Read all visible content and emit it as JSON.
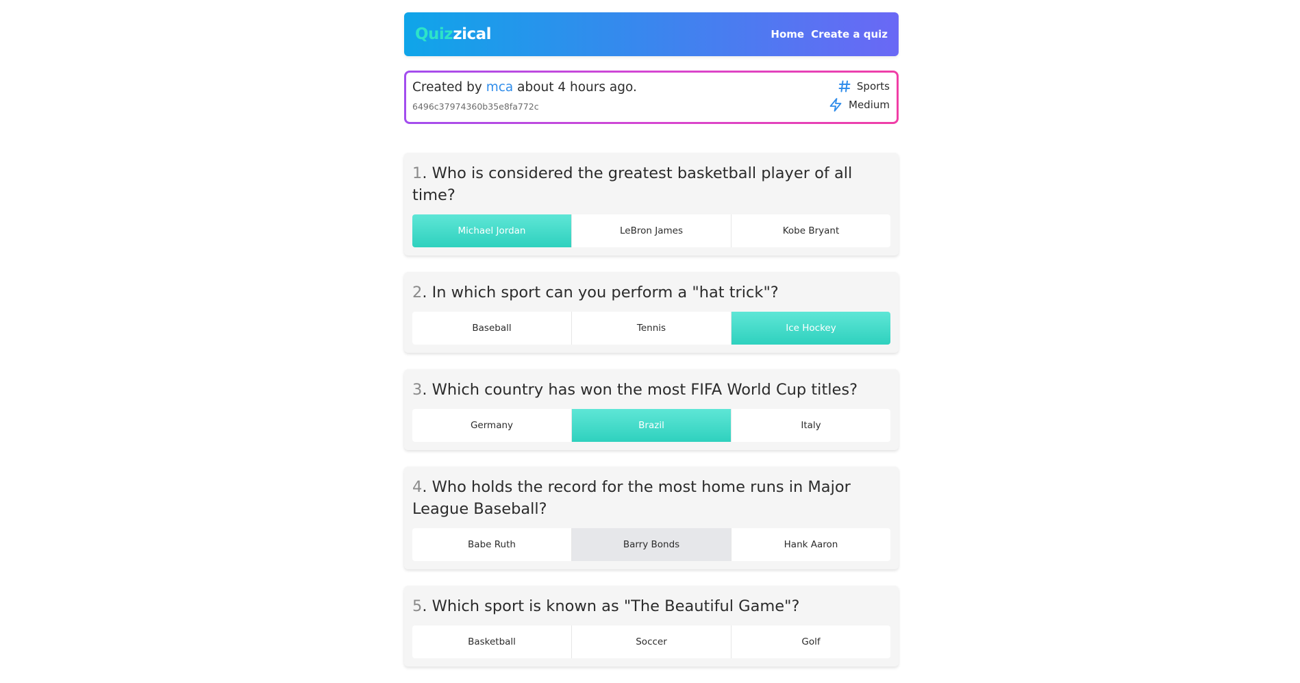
{
  "header": {
    "brand_part1": "Quiz",
    "brand_part2": "zical",
    "nav": [
      "Home",
      "Create a quiz"
    ]
  },
  "info": {
    "created_prefix": "Created by",
    "creator": "mca",
    "created_suffix": "about 4 hours ago.",
    "quiz_id": "6496c37974360b35e8fa772c",
    "category": "Sports",
    "difficulty": "Medium",
    "category_icon": "hash-icon",
    "difficulty_icon": "lightning-icon"
  },
  "questions": [
    {
      "number": "1",
      "text": ". Who is considered the greatest basketball player of all time?",
      "answers": [
        "Michael Jordan",
        "LeBron James",
        "Kobe Bryant"
      ],
      "selected": 0
    },
    {
      "number": "2",
      "text": ". In which sport can you perform a \"hat trick\"?",
      "answers": [
        "Baseball",
        "Tennis",
        "Ice Hockey"
      ],
      "selected": 2
    },
    {
      "number": "3",
      "text": ". Which country has won the most FIFA World Cup titles?",
      "answers": [
        "Germany",
        "Brazil",
        "Italy"
      ],
      "selected": 1
    },
    {
      "number": "4",
      "text": ". Who holds the record for the most home runs in Major League Baseball?",
      "answers": [
        "Babe Ruth",
        "Barry Bonds",
        "Hank Aaron"
      ],
      "selected": null,
      "hovered": 1
    },
    {
      "number": "5",
      "text": ". Which sport is known as \"The Beautiful Game\"?",
      "answers": [
        "Basketball",
        "Soccer",
        "Golf"
      ],
      "selected": null
    }
  ],
  "colors": {
    "selected_answer": "#3cdcc8",
    "hover_answer": "#e6e7ea",
    "creator_link": "#2f8cea",
    "brand_accent": "#2de3c8"
  }
}
